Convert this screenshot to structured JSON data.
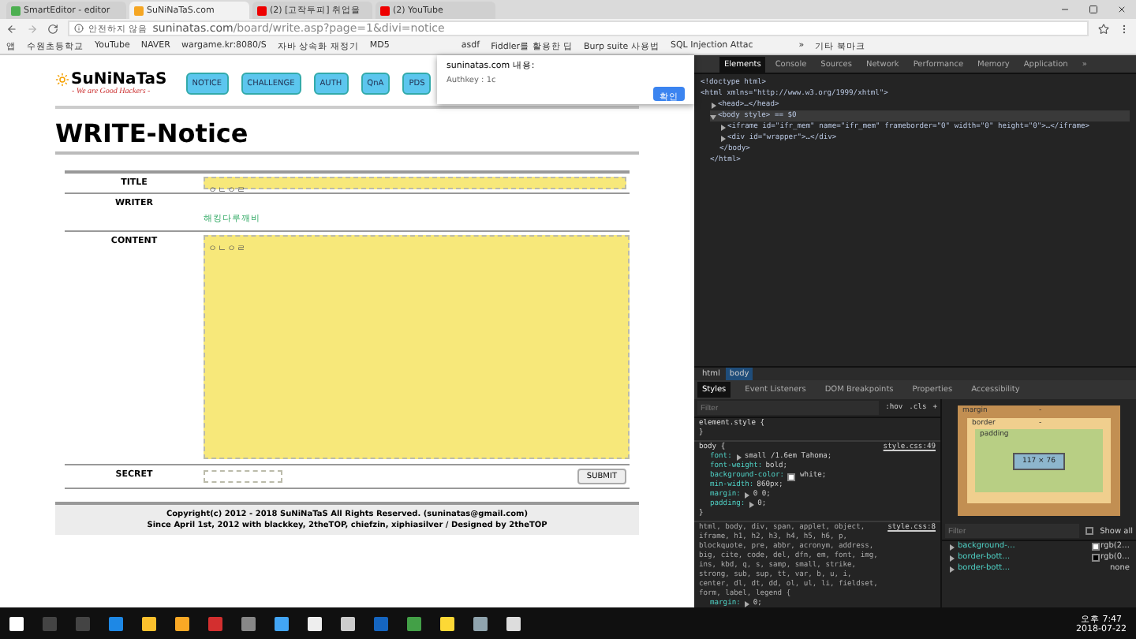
{
  "browser_tabs": [
    {
      "title": "SmartEditor - editor",
      "selected": false
    },
    {
      "title": "SuNiNaTaS.com",
      "selected": true
    },
    {
      "title": "(2) [고작투피] 취업을",
      "selected": false
    },
    {
      "title": "(2) YouTube",
      "selected": false
    }
  ],
  "address_bar": {
    "security": "안전하지 않음",
    "host": "suninatas.com",
    "path": "/board/write.asp?page=1&divi=notice"
  },
  "bookmarks": [
    "앱",
    "수원초등학교",
    "YouTube",
    "NAVER",
    "wargame.kr:8080/S",
    "자바 상속화 재정기",
    "MD5",
    "asdf",
    "Fiddler를 활용한 딥",
    "Burp suite 사용법",
    "SQL Injection Attac",
    "»",
    "기타 북마크"
  ],
  "site": {
    "logo": "SuNiNaTaS",
    "slogan": "- We are Good Hackers -",
    "nav": [
      "NOTICE",
      "CHALLENGE",
      "AUTH",
      "QnA",
      "PDS"
    ],
    "heading": "WRITE-Notice",
    "form": [
      {
        "label": "TITLE",
        "kind": "input",
        "value": "ㅇㄴㅇㄹ"
      },
      {
        "label": "WRITER",
        "kind": "text",
        "value": "해킹다루깨비"
      },
      {
        "label": "CONTENT",
        "kind": "textarea",
        "value": "ㅇㄴㅇㄹ"
      },
      {
        "label": "SECRET",
        "kind": "secret"
      }
    ],
    "submit": "SUBMIT",
    "footer": [
      "Copyright(c) 2012 - 2018 SuNiNaTaS All Rights Reserved. (suninatas@gmail.com)",
      "Since April 1st, 2012 with blackkey, 2theTOP, chiefzin, xiphiasilver / Designed by 2theTOP"
    ]
  },
  "dialog": {
    "title": "suninatas.com 내용:",
    "message": "Authkey : 1c",
    "button": "확인"
  },
  "devtools": {
    "tabs": [
      {
        "label": "Elements",
        "selected": true
      },
      {
        "label": "Console",
        "selected": false
      },
      {
        "label": "Sources",
        "selected": false
      },
      {
        "label": "Network",
        "selected": false
      },
      {
        "label": "Performance",
        "selected": false
      },
      {
        "label": "Memory",
        "selected": false
      },
      {
        "label": "Application",
        "selected": false
      }
    ],
    "more_tabs": "»",
    "dom": [
      {
        "text": "<!doctype html>",
        "selected": false
      },
      {
        "text": "<html xmlns=\"http://www.w3.org/1999/xhtml\">",
        "selected": false,
        "children": [
          {
            "text": "<head>…</head>",
            "selected": false,
            "expanded": false
          },
          {
            "text": "<body style> == $0",
            "selected": true,
            "expanded": true,
            "children": [
              {
                "text": "<iframe id=\"ifr_mem\" name=\"ifr_mem\" frameborder=\"0\" width=\"0\" height=\"0\">…</iframe>",
                "selected": false,
                "expanded": false
              },
              {
                "text": "<div id=\"wrapper\">…</div>",
                "selected": false,
                "expanded": false
              },
              {
                "text": "</body>",
                "selected": false
              }
            ]
          },
          {
            "text": "</html>",
            "selected": false
          }
        ]
      }
    ],
    "breadcrumb": [
      {
        "label": "html",
        "selected": false
      },
      {
        "label": "body",
        "selected": true
      }
    ],
    "subtabs": [
      {
        "label": "Styles",
        "selected": true
      },
      {
        "label": "Event Listeners",
        "selected": false
      },
      {
        "label": "DOM Breakpoints",
        "selected": false
      },
      {
        "label": "Properties",
        "selected": false
      },
      {
        "label": "Accessibility",
        "selected": false
      }
    ],
    "filter": {
      "placeholder": "Filter",
      "hov": ":hov",
      "cls": ".cls",
      "add": "+"
    },
    "rules": [
      {
        "selector": "element.style {",
        "close": "}"
      },
      {
        "selector": "body {",
        "source": "style.css:49",
        "decls": [
          {
            "prop": "font:",
            "value": "small /1.6em Tahoma;",
            "expandable": true
          },
          {
            "prop": "font-weight:",
            "value": "bold;"
          },
          {
            "prop": "background-color:",
            "value": "white;",
            "color": "#ffffff"
          },
          {
            "prop": "min-width:",
            "value": "860px;"
          },
          {
            "prop": "margin:",
            "value": "0 0;",
            "expandable": true
          },
          {
            "prop": "padding:",
            "value": "0;",
            "expandable": true
          }
        ],
        "close": "}"
      },
      {
        "selector": "html, body, div, span, applet, object, iframe, h1, h2, h3, h4, h5, h6, p, blockquote, pre, abbr, acronym, address, big, cite, code, del, dfn, em, font, img, ins, kbd, q, s, samp, small, strike, strong, sub, sup, tt, var, b, u, i, center, dl, dt, dd, ol, ul, li, fieldset, form, label, legend {",
        "source": "style.css:8",
        "decls": [
          {
            "prop": "margin:",
            "value": "0;",
            "expandable": true
          }
        ]
      }
    ],
    "box_model": {
      "margin": "margin",
      "border": "border",
      "padding": "padding",
      "dash": "-",
      "content": "117 × 76"
    },
    "computed": {
      "placeholder": "Filter",
      "show_all": "Show all",
      "show_all_checked": false,
      "rows": [
        {
          "prop": "background-…",
          "value": "rgb(2…",
          "color": "#ffffff"
        },
        {
          "prop": "border-bott…",
          "value": "rgb(0…",
          "color": "#000000"
        },
        {
          "prop": "border-bott…",
          "value": "none"
        }
      ]
    }
  },
  "taskbar": {
    "time": "오후 7:47",
    "date": "2018-07-22"
  }
}
